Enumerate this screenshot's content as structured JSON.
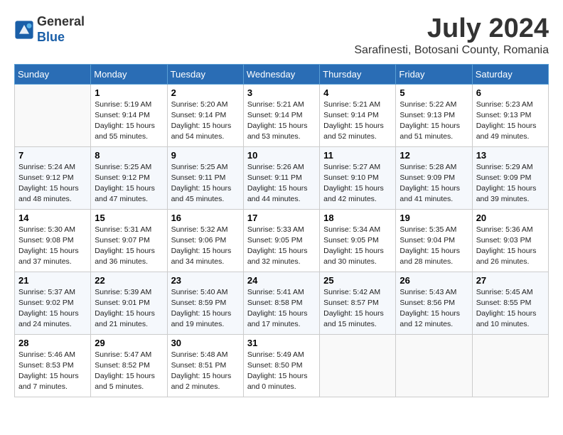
{
  "header": {
    "logo_line1": "General",
    "logo_line2": "Blue",
    "month_year": "July 2024",
    "location": "Sarafinesti, Botosani County, Romania"
  },
  "weekdays": [
    "Sunday",
    "Monday",
    "Tuesday",
    "Wednesday",
    "Thursday",
    "Friday",
    "Saturday"
  ],
  "weeks": [
    [
      {
        "day": "",
        "info": ""
      },
      {
        "day": "1",
        "info": "Sunrise: 5:19 AM\nSunset: 9:14 PM\nDaylight: 15 hours\nand 55 minutes."
      },
      {
        "day": "2",
        "info": "Sunrise: 5:20 AM\nSunset: 9:14 PM\nDaylight: 15 hours\nand 54 minutes."
      },
      {
        "day": "3",
        "info": "Sunrise: 5:21 AM\nSunset: 9:14 PM\nDaylight: 15 hours\nand 53 minutes."
      },
      {
        "day": "4",
        "info": "Sunrise: 5:21 AM\nSunset: 9:14 PM\nDaylight: 15 hours\nand 52 minutes."
      },
      {
        "day": "5",
        "info": "Sunrise: 5:22 AM\nSunset: 9:13 PM\nDaylight: 15 hours\nand 51 minutes."
      },
      {
        "day": "6",
        "info": "Sunrise: 5:23 AM\nSunset: 9:13 PM\nDaylight: 15 hours\nand 49 minutes."
      }
    ],
    [
      {
        "day": "7",
        "info": "Sunrise: 5:24 AM\nSunset: 9:12 PM\nDaylight: 15 hours\nand 48 minutes."
      },
      {
        "day": "8",
        "info": "Sunrise: 5:25 AM\nSunset: 9:12 PM\nDaylight: 15 hours\nand 47 minutes."
      },
      {
        "day": "9",
        "info": "Sunrise: 5:25 AM\nSunset: 9:11 PM\nDaylight: 15 hours\nand 45 minutes."
      },
      {
        "day": "10",
        "info": "Sunrise: 5:26 AM\nSunset: 9:11 PM\nDaylight: 15 hours\nand 44 minutes."
      },
      {
        "day": "11",
        "info": "Sunrise: 5:27 AM\nSunset: 9:10 PM\nDaylight: 15 hours\nand 42 minutes."
      },
      {
        "day": "12",
        "info": "Sunrise: 5:28 AM\nSunset: 9:09 PM\nDaylight: 15 hours\nand 41 minutes."
      },
      {
        "day": "13",
        "info": "Sunrise: 5:29 AM\nSunset: 9:09 PM\nDaylight: 15 hours\nand 39 minutes."
      }
    ],
    [
      {
        "day": "14",
        "info": "Sunrise: 5:30 AM\nSunset: 9:08 PM\nDaylight: 15 hours\nand 37 minutes."
      },
      {
        "day": "15",
        "info": "Sunrise: 5:31 AM\nSunset: 9:07 PM\nDaylight: 15 hours\nand 36 minutes."
      },
      {
        "day": "16",
        "info": "Sunrise: 5:32 AM\nSunset: 9:06 PM\nDaylight: 15 hours\nand 34 minutes."
      },
      {
        "day": "17",
        "info": "Sunrise: 5:33 AM\nSunset: 9:05 PM\nDaylight: 15 hours\nand 32 minutes."
      },
      {
        "day": "18",
        "info": "Sunrise: 5:34 AM\nSunset: 9:05 PM\nDaylight: 15 hours\nand 30 minutes."
      },
      {
        "day": "19",
        "info": "Sunrise: 5:35 AM\nSunset: 9:04 PM\nDaylight: 15 hours\nand 28 minutes."
      },
      {
        "day": "20",
        "info": "Sunrise: 5:36 AM\nSunset: 9:03 PM\nDaylight: 15 hours\nand 26 minutes."
      }
    ],
    [
      {
        "day": "21",
        "info": "Sunrise: 5:37 AM\nSunset: 9:02 PM\nDaylight: 15 hours\nand 24 minutes."
      },
      {
        "day": "22",
        "info": "Sunrise: 5:39 AM\nSunset: 9:01 PM\nDaylight: 15 hours\nand 21 minutes."
      },
      {
        "day": "23",
        "info": "Sunrise: 5:40 AM\nSunset: 8:59 PM\nDaylight: 15 hours\nand 19 minutes."
      },
      {
        "day": "24",
        "info": "Sunrise: 5:41 AM\nSunset: 8:58 PM\nDaylight: 15 hours\nand 17 minutes."
      },
      {
        "day": "25",
        "info": "Sunrise: 5:42 AM\nSunset: 8:57 PM\nDaylight: 15 hours\nand 15 minutes."
      },
      {
        "day": "26",
        "info": "Sunrise: 5:43 AM\nSunset: 8:56 PM\nDaylight: 15 hours\nand 12 minutes."
      },
      {
        "day": "27",
        "info": "Sunrise: 5:45 AM\nSunset: 8:55 PM\nDaylight: 15 hours\nand 10 minutes."
      }
    ],
    [
      {
        "day": "28",
        "info": "Sunrise: 5:46 AM\nSunset: 8:53 PM\nDaylight: 15 hours\nand 7 minutes."
      },
      {
        "day": "29",
        "info": "Sunrise: 5:47 AM\nSunset: 8:52 PM\nDaylight: 15 hours\nand 5 minutes."
      },
      {
        "day": "30",
        "info": "Sunrise: 5:48 AM\nSunset: 8:51 PM\nDaylight: 15 hours\nand 2 minutes."
      },
      {
        "day": "31",
        "info": "Sunrise: 5:49 AM\nSunset: 8:50 PM\nDaylight: 15 hours\nand 0 minutes."
      },
      {
        "day": "",
        "info": ""
      },
      {
        "day": "",
        "info": ""
      },
      {
        "day": "",
        "info": ""
      }
    ]
  ]
}
